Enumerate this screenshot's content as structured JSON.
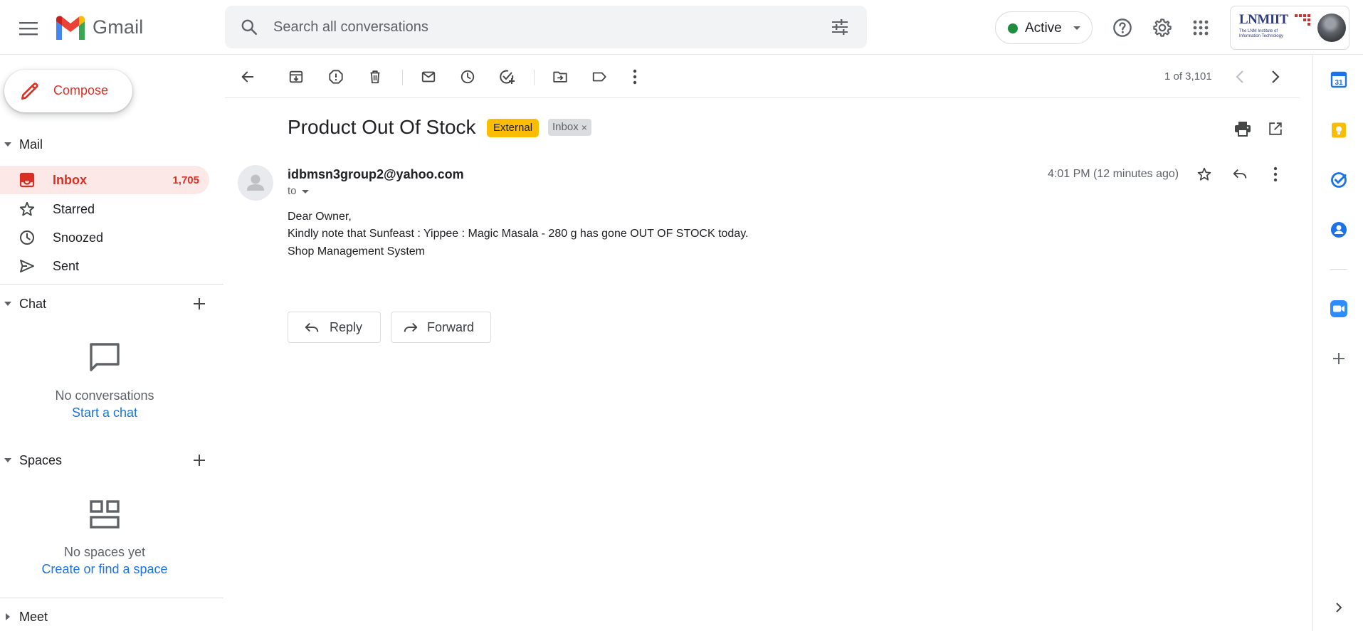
{
  "app": {
    "name": "Gmail"
  },
  "search": {
    "placeholder": "Search all conversations"
  },
  "status": {
    "label": "Active",
    "color": "#1e8e3e"
  },
  "account": {
    "org_name": "LNMIIT",
    "org_subtitle": "The LNM Institute of Information Technology"
  },
  "sidebar": {
    "compose_label": "Compose",
    "mail_section": "Mail",
    "items": [
      {
        "label": "Inbox",
        "count": "1,705",
        "icon": "inbox-icon"
      },
      {
        "label": "Starred",
        "count": "",
        "icon": "star-icon"
      },
      {
        "label": "Snoozed",
        "count": "",
        "icon": "clock-icon"
      },
      {
        "label": "Sent",
        "count": "",
        "icon": "send-icon"
      }
    ],
    "chat": {
      "section": "Chat",
      "empty_text": "No conversations",
      "link": "Start a chat"
    },
    "spaces": {
      "section": "Spaces",
      "empty_text": "No spaces yet",
      "link": "Create or find a space"
    },
    "meet_section": "Meet"
  },
  "toolbar": {
    "pager": "1 of 3,101"
  },
  "message": {
    "subject": "Product Out Of Stock",
    "labels": {
      "external": "External",
      "inbox": "Inbox"
    },
    "sender": "idbmsn3group2@yahoo.com",
    "to": "to",
    "timestamp": "4:01 PM (12 minutes ago)",
    "body": [
      "Dear Owner,",
      "Kindly note that Sunfeast : Yippee : Magic Masala - 280 g has gone OUT OF STOCK today.",
      "Shop Management System"
    ],
    "reply_label": "Reply",
    "forward_label": "Forward"
  },
  "colors": {
    "accent_red": "#d93025",
    "link_blue": "#1a73e8",
    "label_external": "#fbbc04",
    "active_nav_bg": "#fce8e6"
  }
}
